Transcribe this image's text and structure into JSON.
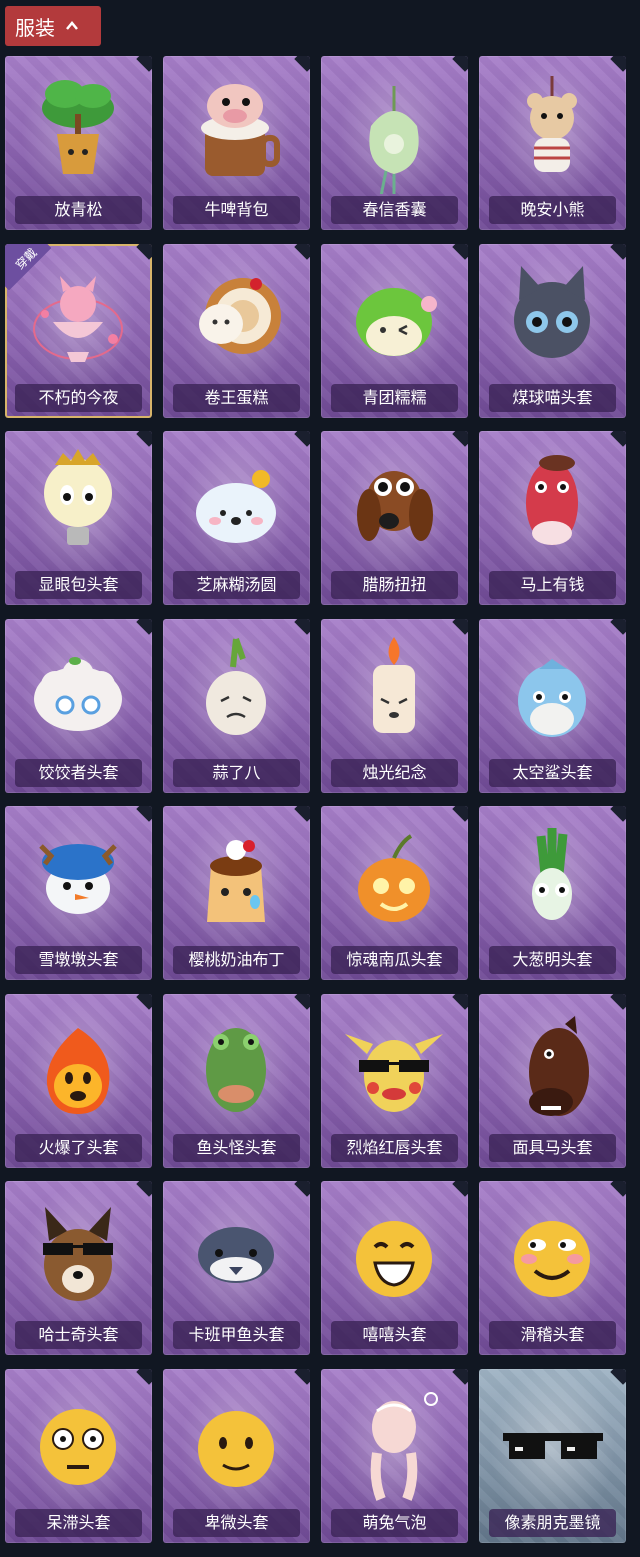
{
  "header": {
    "tab_label": "服装",
    "icon": "chevron-up-icon",
    "accent": "#b33a3c"
  },
  "worn_badge_text": "穿戴",
  "items": [
    {
      "name": "放青松",
      "icon": "bonsai-tree-icon",
      "worn": false,
      "rarity": "purple"
    },
    {
      "name": "牛啤背包",
      "icon": "cow-beer-mug-icon",
      "worn": false,
      "rarity": "purple"
    },
    {
      "name": "春信香囊",
      "icon": "sachet-icon",
      "worn": false,
      "rarity": "purple"
    },
    {
      "name": "晚安小熊",
      "icon": "teddy-bear-icon",
      "worn": false,
      "rarity": "purple"
    },
    {
      "name": "不朽的今夜",
      "icon": "pink-fox-bowl-icon",
      "worn": true,
      "rarity": "purple"
    },
    {
      "name": "卷王蛋糕",
      "icon": "roll-cake-icon",
      "worn": false,
      "rarity": "purple"
    },
    {
      "name": "青团糯糯",
      "icon": "green-dumpling-icon",
      "worn": false,
      "rarity": "purple"
    },
    {
      "name": "煤球喵头套",
      "icon": "black-cat-head-icon",
      "worn": false,
      "rarity": "purple"
    },
    {
      "name": "显眼包头套",
      "icon": "lightbulb-head-icon",
      "worn": false,
      "rarity": "purple"
    },
    {
      "name": "芝麻糊汤圆",
      "icon": "rice-ball-icon",
      "worn": false,
      "rarity": "purple"
    },
    {
      "name": "腊肠扭扭",
      "icon": "dachshund-head-icon",
      "worn": false,
      "rarity": "purple"
    },
    {
      "name": "马上有钱",
      "icon": "red-horse-head-icon",
      "worn": false,
      "rarity": "purple"
    },
    {
      "name": "饺饺者头套",
      "icon": "dumpling-head-icon",
      "worn": false,
      "rarity": "purple"
    },
    {
      "name": "蒜了八",
      "icon": "garlic-head-icon",
      "worn": false,
      "rarity": "purple"
    },
    {
      "name": "烛光纪念",
      "icon": "candle-head-icon",
      "worn": false,
      "rarity": "purple"
    },
    {
      "name": "太空鲨头套",
      "icon": "shark-head-icon",
      "worn": false,
      "rarity": "purple"
    },
    {
      "name": "雪墩墩头套",
      "icon": "snowman-head-icon",
      "worn": false,
      "rarity": "purple"
    },
    {
      "name": "樱桃奶油布丁",
      "icon": "pudding-head-icon",
      "worn": false,
      "rarity": "purple"
    },
    {
      "name": "惊魂南瓜头套",
      "icon": "pumpkin-head-icon",
      "worn": false,
      "rarity": "purple"
    },
    {
      "name": "大葱明头套",
      "icon": "scallion-head-icon",
      "worn": false,
      "rarity": "purple"
    },
    {
      "name": "火爆了头套",
      "icon": "fire-head-icon",
      "worn": false,
      "rarity": "purple"
    },
    {
      "name": "鱼头怪头套",
      "icon": "fish-head-mask-icon",
      "worn": false,
      "rarity": "purple"
    },
    {
      "name": "烈焰红唇头套",
      "icon": "pikachu-lips-head-icon",
      "worn": false,
      "rarity": "purple"
    },
    {
      "name": "面具马头套",
      "icon": "horse-mask-icon",
      "worn": false,
      "rarity": "purple"
    },
    {
      "name": "哈士奇头套",
      "icon": "husky-head-icon",
      "worn": false,
      "rarity": "purple"
    },
    {
      "name": "卡班甲鱼头套",
      "icon": "turtle-head-icon",
      "worn": false,
      "rarity": "purple"
    },
    {
      "name": "嘻嘻头套",
      "icon": "grin-emoji-head-icon",
      "worn": false,
      "rarity": "purple"
    },
    {
      "name": "滑稽头套",
      "icon": "funny-emoji-head-icon",
      "worn": false,
      "rarity": "purple"
    },
    {
      "name": "呆滞头套",
      "icon": "dazed-emoji-head-icon",
      "worn": false,
      "rarity": "purple"
    },
    {
      "name": "卑微头套",
      "icon": "humble-emoji-head-icon",
      "worn": false,
      "rarity": "purple"
    },
    {
      "name": "萌兔气泡",
      "icon": "bunny-bubble-icon",
      "worn": false,
      "rarity": "purple"
    },
    {
      "name": "像素朋克墨镜",
      "icon": "pixel-sunglasses-icon",
      "worn": false,
      "rarity": "grey"
    }
  ]
}
